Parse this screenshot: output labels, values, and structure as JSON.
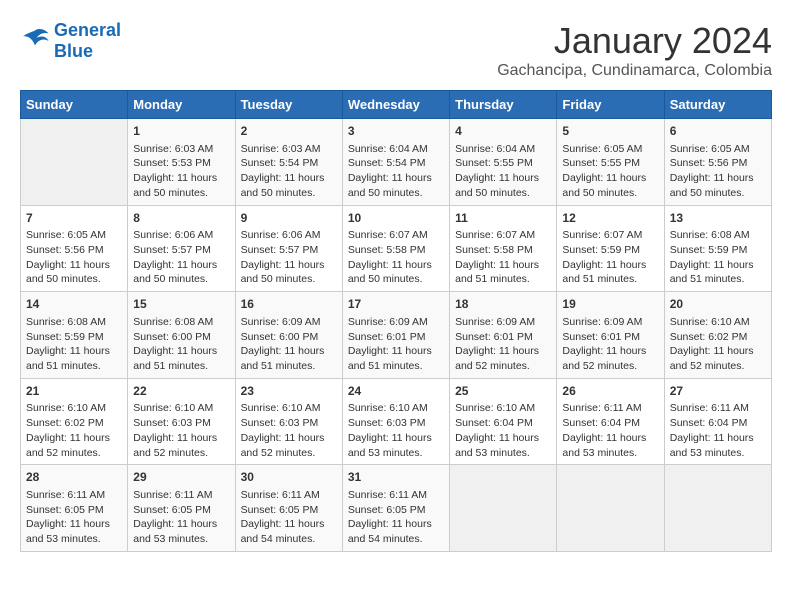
{
  "header": {
    "logo_line1": "General",
    "logo_line2": "Blue",
    "month": "January 2024",
    "location": "Gachancipa, Cundinamarca, Colombia"
  },
  "weekdays": [
    "Sunday",
    "Monday",
    "Tuesday",
    "Wednesday",
    "Thursday",
    "Friday",
    "Saturday"
  ],
  "weeks": [
    [
      {
        "day": "",
        "info": ""
      },
      {
        "day": "1",
        "info": "Sunrise: 6:03 AM\nSunset: 5:53 PM\nDaylight: 11 hours\nand 50 minutes."
      },
      {
        "day": "2",
        "info": "Sunrise: 6:03 AM\nSunset: 5:54 PM\nDaylight: 11 hours\nand 50 minutes."
      },
      {
        "day": "3",
        "info": "Sunrise: 6:04 AM\nSunset: 5:54 PM\nDaylight: 11 hours\nand 50 minutes."
      },
      {
        "day": "4",
        "info": "Sunrise: 6:04 AM\nSunset: 5:55 PM\nDaylight: 11 hours\nand 50 minutes."
      },
      {
        "day": "5",
        "info": "Sunrise: 6:05 AM\nSunset: 5:55 PM\nDaylight: 11 hours\nand 50 minutes."
      },
      {
        "day": "6",
        "info": "Sunrise: 6:05 AM\nSunset: 5:56 PM\nDaylight: 11 hours\nand 50 minutes."
      }
    ],
    [
      {
        "day": "7",
        "info": "Sunrise: 6:05 AM\nSunset: 5:56 PM\nDaylight: 11 hours\nand 50 minutes."
      },
      {
        "day": "8",
        "info": "Sunrise: 6:06 AM\nSunset: 5:57 PM\nDaylight: 11 hours\nand 50 minutes."
      },
      {
        "day": "9",
        "info": "Sunrise: 6:06 AM\nSunset: 5:57 PM\nDaylight: 11 hours\nand 50 minutes."
      },
      {
        "day": "10",
        "info": "Sunrise: 6:07 AM\nSunset: 5:58 PM\nDaylight: 11 hours\nand 50 minutes."
      },
      {
        "day": "11",
        "info": "Sunrise: 6:07 AM\nSunset: 5:58 PM\nDaylight: 11 hours\nand 51 minutes."
      },
      {
        "day": "12",
        "info": "Sunrise: 6:07 AM\nSunset: 5:59 PM\nDaylight: 11 hours\nand 51 minutes."
      },
      {
        "day": "13",
        "info": "Sunrise: 6:08 AM\nSunset: 5:59 PM\nDaylight: 11 hours\nand 51 minutes."
      }
    ],
    [
      {
        "day": "14",
        "info": "Sunrise: 6:08 AM\nSunset: 5:59 PM\nDaylight: 11 hours\nand 51 minutes."
      },
      {
        "day": "15",
        "info": "Sunrise: 6:08 AM\nSunset: 6:00 PM\nDaylight: 11 hours\nand 51 minutes."
      },
      {
        "day": "16",
        "info": "Sunrise: 6:09 AM\nSunset: 6:00 PM\nDaylight: 11 hours\nand 51 minutes."
      },
      {
        "day": "17",
        "info": "Sunrise: 6:09 AM\nSunset: 6:01 PM\nDaylight: 11 hours\nand 51 minutes."
      },
      {
        "day": "18",
        "info": "Sunrise: 6:09 AM\nSunset: 6:01 PM\nDaylight: 11 hours\nand 52 minutes."
      },
      {
        "day": "19",
        "info": "Sunrise: 6:09 AM\nSunset: 6:01 PM\nDaylight: 11 hours\nand 52 minutes."
      },
      {
        "day": "20",
        "info": "Sunrise: 6:10 AM\nSunset: 6:02 PM\nDaylight: 11 hours\nand 52 minutes."
      }
    ],
    [
      {
        "day": "21",
        "info": "Sunrise: 6:10 AM\nSunset: 6:02 PM\nDaylight: 11 hours\nand 52 minutes."
      },
      {
        "day": "22",
        "info": "Sunrise: 6:10 AM\nSunset: 6:03 PM\nDaylight: 11 hours\nand 52 minutes."
      },
      {
        "day": "23",
        "info": "Sunrise: 6:10 AM\nSunset: 6:03 PM\nDaylight: 11 hours\nand 52 minutes."
      },
      {
        "day": "24",
        "info": "Sunrise: 6:10 AM\nSunset: 6:03 PM\nDaylight: 11 hours\nand 53 minutes."
      },
      {
        "day": "25",
        "info": "Sunrise: 6:10 AM\nSunset: 6:04 PM\nDaylight: 11 hours\nand 53 minutes."
      },
      {
        "day": "26",
        "info": "Sunrise: 6:11 AM\nSunset: 6:04 PM\nDaylight: 11 hours\nand 53 minutes."
      },
      {
        "day": "27",
        "info": "Sunrise: 6:11 AM\nSunset: 6:04 PM\nDaylight: 11 hours\nand 53 minutes."
      }
    ],
    [
      {
        "day": "28",
        "info": "Sunrise: 6:11 AM\nSunset: 6:05 PM\nDaylight: 11 hours\nand 53 minutes."
      },
      {
        "day": "29",
        "info": "Sunrise: 6:11 AM\nSunset: 6:05 PM\nDaylight: 11 hours\nand 53 minutes."
      },
      {
        "day": "30",
        "info": "Sunrise: 6:11 AM\nSunset: 6:05 PM\nDaylight: 11 hours\nand 54 minutes."
      },
      {
        "day": "31",
        "info": "Sunrise: 6:11 AM\nSunset: 6:05 PM\nDaylight: 11 hours\nand 54 minutes."
      },
      {
        "day": "",
        "info": ""
      },
      {
        "day": "",
        "info": ""
      },
      {
        "day": "",
        "info": ""
      }
    ]
  ]
}
